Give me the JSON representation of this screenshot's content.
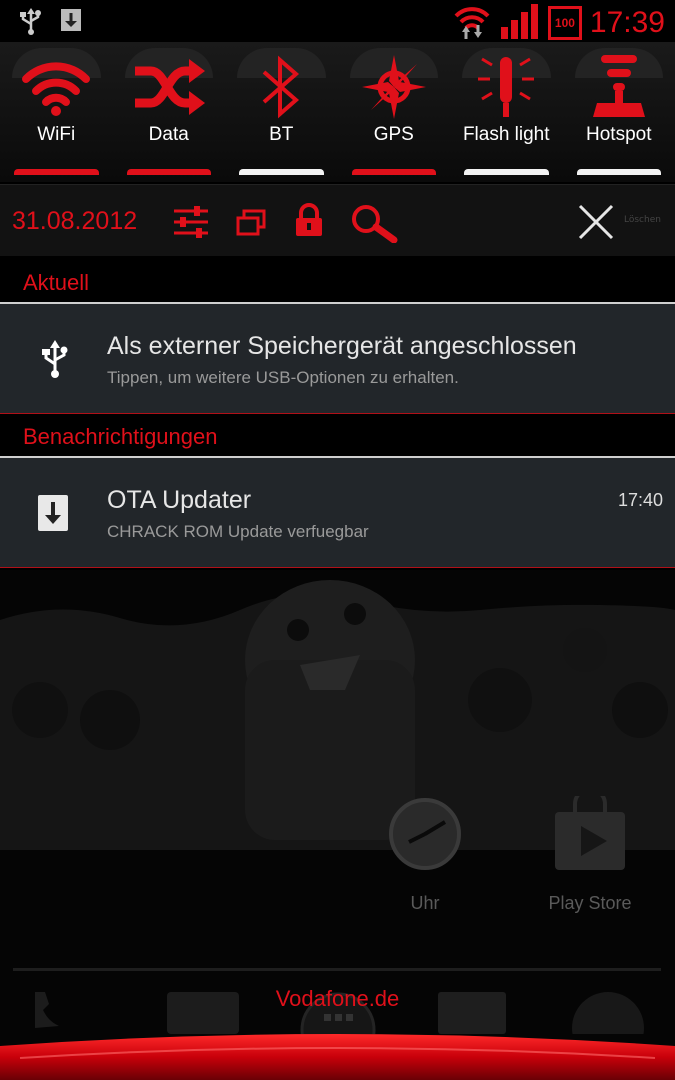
{
  "status_bar": {
    "time": "17:39",
    "battery": "100"
  },
  "toggles": [
    {
      "label": "WiFi",
      "icon": "wifi-icon",
      "state": "on"
    },
    {
      "label": "Data",
      "icon": "shuffle-icon",
      "state": "on"
    },
    {
      "label": "BT",
      "icon": "bluetooth-icon",
      "state": "off"
    },
    {
      "label": "GPS",
      "icon": "gps-icon",
      "state": "on"
    },
    {
      "label": "Flash light",
      "icon": "flashlight-icon",
      "state": "off"
    },
    {
      "label": "Hotspot",
      "icon": "hotspot-icon",
      "state": "off"
    }
  ],
  "date_row": {
    "date": "31.08.2012",
    "clear_label": "Löschen"
  },
  "sections": {
    "ongoing": "Aktuell",
    "notifications": "Benachrichtigungen"
  },
  "ongoing_item": {
    "title": "Als externer Speichergerät angeschlossen",
    "subtitle": "Tippen, um weitere USB-Optionen zu erhalten."
  },
  "notification_item": {
    "title": "OTA Updater",
    "subtitle": "CHRACK ROM Update verfuegbar",
    "time": "17:40"
  },
  "home": {
    "apps": [
      {
        "label": "Uhr"
      },
      {
        "label": "Play Store"
      }
    ],
    "carrier": "Vodafone.de"
  },
  "colors": {
    "accent": "#e0101a",
    "panel": "#22262a",
    "background": "#000000"
  }
}
